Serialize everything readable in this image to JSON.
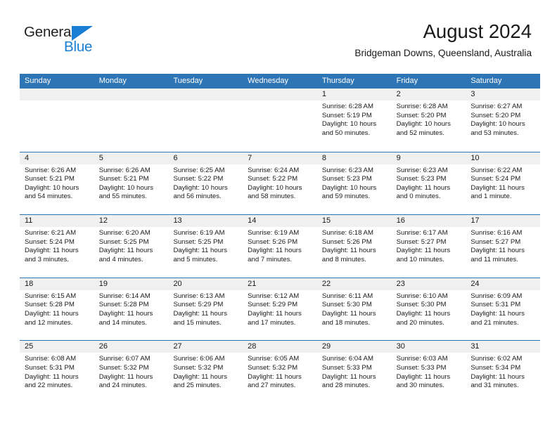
{
  "brand": {
    "name_part1": "General",
    "name_part2": "Blue",
    "triangle_color": "#1a7fd4",
    "text_color": "#231f20"
  },
  "header": {
    "title": "August 2024",
    "subtitle": "Bridgeman Downs, Queensland, Australia"
  },
  "colors": {
    "header_band": "#2e75b6",
    "day_band": "#f0f0f0",
    "text": "#1a1a1a",
    "header_text": "#ffffff"
  },
  "weekdays": [
    "Sunday",
    "Monday",
    "Tuesday",
    "Wednesday",
    "Thursday",
    "Friday",
    "Saturday"
  ],
  "weeks": [
    [
      {
        "day": "",
        "lines": []
      },
      {
        "day": "",
        "lines": []
      },
      {
        "day": "",
        "lines": []
      },
      {
        "day": "",
        "lines": []
      },
      {
        "day": "1",
        "lines": [
          "Sunrise: 6:28 AM",
          "Sunset: 5:19 PM",
          "Daylight: 10 hours",
          "and 50 minutes."
        ]
      },
      {
        "day": "2",
        "lines": [
          "Sunrise: 6:28 AM",
          "Sunset: 5:20 PM",
          "Daylight: 10 hours",
          "and 52 minutes."
        ]
      },
      {
        "day": "3",
        "lines": [
          "Sunrise: 6:27 AM",
          "Sunset: 5:20 PM",
          "Daylight: 10 hours",
          "and 53 minutes."
        ]
      }
    ],
    [
      {
        "day": "4",
        "lines": [
          "Sunrise: 6:26 AM",
          "Sunset: 5:21 PM",
          "Daylight: 10 hours",
          "and 54 minutes."
        ]
      },
      {
        "day": "5",
        "lines": [
          "Sunrise: 6:26 AM",
          "Sunset: 5:21 PM",
          "Daylight: 10 hours",
          "and 55 minutes."
        ]
      },
      {
        "day": "6",
        "lines": [
          "Sunrise: 6:25 AM",
          "Sunset: 5:22 PM",
          "Daylight: 10 hours",
          "and 56 minutes."
        ]
      },
      {
        "day": "7",
        "lines": [
          "Sunrise: 6:24 AM",
          "Sunset: 5:22 PM",
          "Daylight: 10 hours",
          "and 58 minutes."
        ]
      },
      {
        "day": "8",
        "lines": [
          "Sunrise: 6:23 AM",
          "Sunset: 5:23 PM",
          "Daylight: 10 hours",
          "and 59 minutes."
        ]
      },
      {
        "day": "9",
        "lines": [
          "Sunrise: 6:23 AM",
          "Sunset: 5:23 PM",
          "Daylight: 11 hours",
          "and 0 minutes."
        ]
      },
      {
        "day": "10",
        "lines": [
          "Sunrise: 6:22 AM",
          "Sunset: 5:24 PM",
          "Daylight: 11 hours",
          "and 1 minute."
        ]
      }
    ],
    [
      {
        "day": "11",
        "lines": [
          "Sunrise: 6:21 AM",
          "Sunset: 5:24 PM",
          "Daylight: 11 hours",
          "and 3 minutes."
        ]
      },
      {
        "day": "12",
        "lines": [
          "Sunrise: 6:20 AM",
          "Sunset: 5:25 PM",
          "Daylight: 11 hours",
          "and 4 minutes."
        ]
      },
      {
        "day": "13",
        "lines": [
          "Sunrise: 6:19 AM",
          "Sunset: 5:25 PM",
          "Daylight: 11 hours",
          "and 5 minutes."
        ]
      },
      {
        "day": "14",
        "lines": [
          "Sunrise: 6:19 AM",
          "Sunset: 5:26 PM",
          "Daylight: 11 hours",
          "and 7 minutes."
        ]
      },
      {
        "day": "15",
        "lines": [
          "Sunrise: 6:18 AM",
          "Sunset: 5:26 PM",
          "Daylight: 11 hours",
          "and 8 minutes."
        ]
      },
      {
        "day": "16",
        "lines": [
          "Sunrise: 6:17 AM",
          "Sunset: 5:27 PM",
          "Daylight: 11 hours",
          "and 10 minutes."
        ]
      },
      {
        "day": "17",
        "lines": [
          "Sunrise: 6:16 AM",
          "Sunset: 5:27 PM",
          "Daylight: 11 hours",
          "and 11 minutes."
        ]
      }
    ],
    [
      {
        "day": "18",
        "lines": [
          "Sunrise: 6:15 AM",
          "Sunset: 5:28 PM",
          "Daylight: 11 hours",
          "and 12 minutes."
        ]
      },
      {
        "day": "19",
        "lines": [
          "Sunrise: 6:14 AM",
          "Sunset: 5:28 PM",
          "Daylight: 11 hours",
          "and 14 minutes."
        ]
      },
      {
        "day": "20",
        "lines": [
          "Sunrise: 6:13 AM",
          "Sunset: 5:29 PM",
          "Daylight: 11 hours",
          "and 15 minutes."
        ]
      },
      {
        "day": "21",
        "lines": [
          "Sunrise: 6:12 AM",
          "Sunset: 5:29 PM",
          "Daylight: 11 hours",
          "and 17 minutes."
        ]
      },
      {
        "day": "22",
        "lines": [
          "Sunrise: 6:11 AM",
          "Sunset: 5:30 PM",
          "Daylight: 11 hours",
          "and 18 minutes."
        ]
      },
      {
        "day": "23",
        "lines": [
          "Sunrise: 6:10 AM",
          "Sunset: 5:30 PM",
          "Daylight: 11 hours",
          "and 20 minutes."
        ]
      },
      {
        "day": "24",
        "lines": [
          "Sunrise: 6:09 AM",
          "Sunset: 5:31 PM",
          "Daylight: 11 hours",
          "and 21 minutes."
        ]
      }
    ],
    [
      {
        "day": "25",
        "lines": [
          "Sunrise: 6:08 AM",
          "Sunset: 5:31 PM",
          "Daylight: 11 hours",
          "and 22 minutes."
        ]
      },
      {
        "day": "26",
        "lines": [
          "Sunrise: 6:07 AM",
          "Sunset: 5:32 PM",
          "Daylight: 11 hours",
          "and 24 minutes."
        ]
      },
      {
        "day": "27",
        "lines": [
          "Sunrise: 6:06 AM",
          "Sunset: 5:32 PM",
          "Daylight: 11 hours",
          "and 25 minutes."
        ]
      },
      {
        "day": "28",
        "lines": [
          "Sunrise: 6:05 AM",
          "Sunset: 5:32 PM",
          "Daylight: 11 hours",
          "and 27 minutes."
        ]
      },
      {
        "day": "29",
        "lines": [
          "Sunrise: 6:04 AM",
          "Sunset: 5:33 PM",
          "Daylight: 11 hours",
          "and 28 minutes."
        ]
      },
      {
        "day": "30",
        "lines": [
          "Sunrise: 6:03 AM",
          "Sunset: 5:33 PM",
          "Daylight: 11 hours",
          "and 30 minutes."
        ]
      },
      {
        "day": "31",
        "lines": [
          "Sunrise: 6:02 AM",
          "Sunset: 5:34 PM",
          "Daylight: 11 hours",
          "and 31 minutes."
        ]
      }
    ]
  ]
}
